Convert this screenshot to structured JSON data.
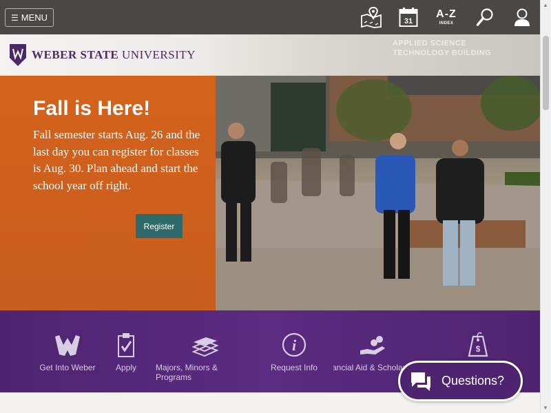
{
  "header": {
    "menu_label": "MENU",
    "calendar_day": "31",
    "az_big": "A-Z",
    "az_small": "INDEX"
  },
  "logo": {
    "name_bold": "WEBER STATE",
    "name_regular": "UNIVERSITY"
  },
  "background_sign": {
    "line1": "APPLIED SCIENCE",
    "line2": "TECHNOLOGY BUILDING"
  },
  "hero": {
    "title": "Fall is Here!",
    "body": "Fall semester starts Aug. 26 and the last day you can register for classes is Aug. 30. Plan ahead and start the school year off right.",
    "button_label": "Register"
  },
  "nav": {
    "items": [
      {
        "label": "Get Into Weber",
        "icon": "hands-w-icon"
      },
      {
        "label": "Apply",
        "icon": "clipboard-check-icon"
      },
      {
        "label": "Majors, Minors & Programs",
        "icon": "books-icon"
      },
      {
        "label": "Request Info",
        "icon": "info-icon"
      },
      {
        "label": "Financial Aid & Scholarships",
        "icon": "hand-money-icon"
      },
      {
        "label": "",
        "icon": "price-tag-icon"
      }
    ]
  },
  "chat": {
    "label": "Questions?"
  },
  "colors": {
    "topbar": "#4a4846",
    "hero_orange": "#d4621b",
    "register_teal": "#2f6a6a",
    "purple": "#4e2470"
  }
}
